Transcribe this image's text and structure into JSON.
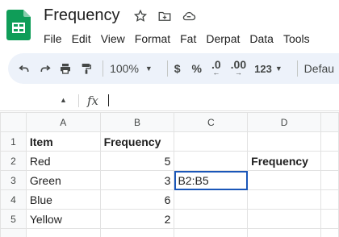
{
  "header": {
    "title": "Frequency",
    "menu": [
      "File",
      "Edit",
      "View",
      "Format",
      "Fat",
      "Derpat",
      "Data",
      "Tools"
    ]
  },
  "toolbar": {
    "zoom": "100%",
    "currency": "$",
    "percent": "%",
    "decrease_decimal": ".0",
    "increase_decimal": ".00",
    "more_formats": "123",
    "font": "Defau"
  },
  "formula_bar": {
    "fx": "fx"
  },
  "grid": {
    "columns": [
      "A",
      "B",
      "C",
      "D"
    ],
    "rows": [
      {
        "num": "1",
        "cells": [
          "Item",
          "Frequency",
          "",
          ""
        ]
      },
      {
        "num": "2",
        "cells": [
          "Red",
          "5",
          "",
          "Frequency"
        ]
      },
      {
        "num": "3",
        "cells": [
          "Green",
          "3",
          "B2:B5",
          ""
        ]
      },
      {
        "num": "4",
        "cells": [
          "Blue",
          "6",
          "",
          ""
        ]
      },
      {
        "num": "5",
        "cells": [
          "Yellow",
          "2",
          "",
          ""
        ]
      },
      {
        "num": "",
        "cells": [
          "",
          "",
          "",
          ""
        ]
      }
    ]
  },
  "colors": {
    "sheets_green": "#0f9d58",
    "toolbar_bg": "#edf2fa",
    "selection": "#1a56b8"
  }
}
